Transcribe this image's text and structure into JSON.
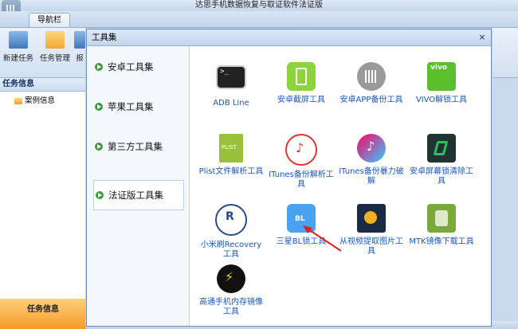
{
  "app": {
    "title": "达思手机数据恢复与取证软件法证版",
    "nav_tab": "导航栏"
  },
  "ribbon": {
    "items": [
      "新建任务",
      "任务管理",
      "报"
    ]
  },
  "left_panel": {
    "header": "任务信息",
    "tree_item": "案例信息",
    "footer": "任务信息"
  },
  "bottom_strip": "»",
  "dialog": {
    "title": "工具集",
    "close": "×",
    "categories": [
      {
        "label": "安卓工具集"
      },
      {
        "label": "苹果工具集"
      },
      {
        "label": "第三方工具集"
      },
      {
        "label": "法证版工具集"
      }
    ],
    "tools": [
      {
        "label": "ADB Line",
        "icon": "terminal-icon"
      },
      {
        "label": "安卓截屏工具",
        "icon": "screenshot-icon"
      },
      {
        "label": "安卓APP备份工具",
        "icon": "apk-backup-icon"
      },
      {
        "label": "VIVO解锁工具",
        "icon": "vivo-unlock-icon"
      },
      {
        "label": "Plist文件解析工具",
        "icon": "plist-icon"
      },
      {
        "label": "ITunes备份解析工具",
        "icon": "itunes-icon"
      },
      {
        "label": "ITunes备份暴力破解",
        "icon": "itunes-crack-icon"
      },
      {
        "label": "安卓屏幕锁清除工具",
        "icon": "screen-lock-icon"
      },
      {
        "label": "小米刷Recovery工具",
        "icon": "recovery-icon"
      },
      {
        "label": "三星BL锁工具",
        "icon": "bl-lock-icon"
      },
      {
        "label": "从视频提取图片工具",
        "icon": "video-extract-icon"
      },
      {
        "label": "MTK镜像下载工具",
        "icon": "mtk-icon"
      },
      {
        "label": "高通手机内存镜像工具",
        "icon": "qualcomm-icon"
      }
    ]
  },
  "colors": {
    "link": "#1b56b5",
    "accent_orange": "#f59a2a",
    "arrow": "#e02020"
  }
}
